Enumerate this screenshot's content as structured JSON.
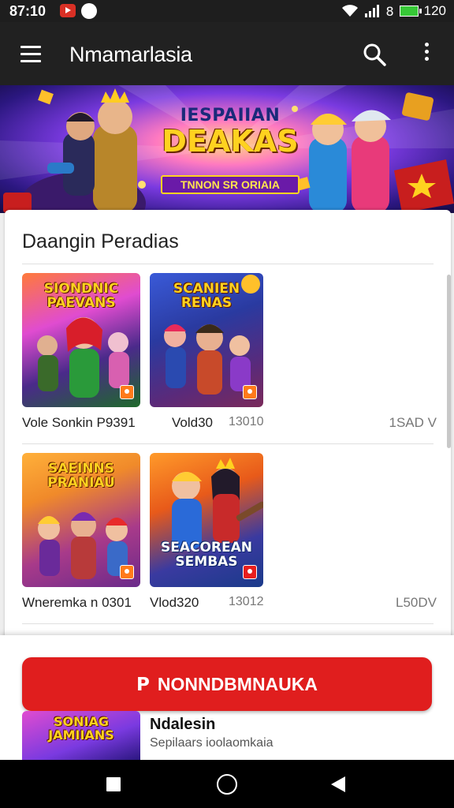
{
  "status_bar": {
    "time": "87:10",
    "misc": "8",
    "battery": "120",
    "icons": [
      "youtube-icon",
      "notification-dot-icon",
      "wifi-icon",
      "signal-icon",
      "battery-icon"
    ]
  },
  "app_bar": {
    "title": "Nmamarlasia",
    "icons": [
      "menu-icon",
      "search-icon",
      "more-vert-icon"
    ]
  },
  "banner": {
    "title_line1": "IESPAIIAN",
    "title_line2": "DEAKAS",
    "subtitle": "TNNON SR ORIAIA"
  },
  "section": {
    "title": "Daangin Peradias"
  },
  "rows": [
    {
      "items": [
        {
          "tile_title": "SIONDNIC PAEVANS",
          "label": "Vole Sonkin P9391",
          "color_top": "#e04cd0",
          "color_bottom": "#1e6a2a"
        },
        {
          "tile_title": "SCANIEN RENAS",
          "label": "Vold30",
          "color_top": "#2a3aa0",
          "color_bottom": "#7a2a5a"
        }
      ],
      "number": "13010",
      "right": "1SAD V"
    },
    {
      "items": [
        {
          "tile_title": "SAEINNS PRANIAU",
          "label": "Wneremka n 0301",
          "color_top": "#f08a2a",
          "color_bottom": "#6a2a8a"
        },
        {
          "tile_title": "SEACOREAN SEMBAS",
          "label": "Vlod320",
          "color_top": "#e85a1a",
          "color_bottom": "#1a3a8a"
        }
      ],
      "number": "13012",
      "right": "L50DV"
    }
  ],
  "cta": {
    "icon": "P",
    "label": "NONNDBMNAUKA"
  },
  "mini_item": {
    "thumb_title": "SONIAG JAMIIANS",
    "title": "Ndalesin",
    "subtitle": "Sepilaars ioolaomkaia"
  },
  "nav": {
    "icons": [
      "recent-apps-icon",
      "home-icon",
      "back-icon"
    ]
  },
  "colors": {
    "status_bar": "#1e1e1e",
    "app_bar": "#212121",
    "cta": "#e01e1e",
    "battery": "#37c837"
  }
}
